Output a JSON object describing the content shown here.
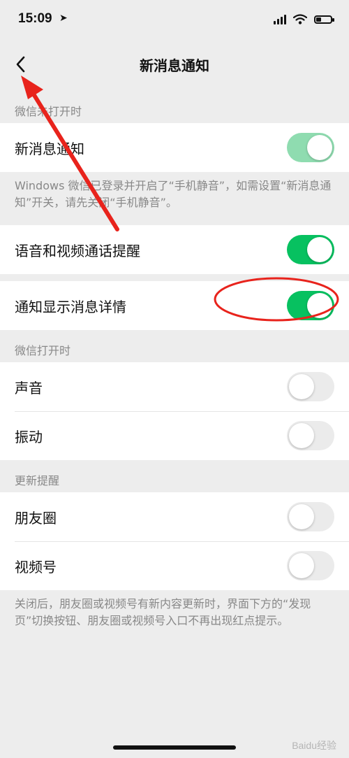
{
  "status_bar": {
    "time": "15:09",
    "location_icon": "location-arrow-icon",
    "battery_level": 0.35
  },
  "nav": {
    "title": "新消息通知",
    "back_icon": "chevron-left-icon"
  },
  "sections": {
    "pc_open": {
      "label": "微信未打开时",
      "items": [
        {
          "label": "新消息通知",
          "enabled": true
        }
      ],
      "note": "Windows 微信已登录并开启了“手机静音”，如需设置“新消息通知”开关，请先关闭“手机静音”。"
    },
    "call_reminder": {
      "label": "语音和视频通话提醒",
      "enabled": true
    },
    "show_details": {
      "label": "通知显示消息详情",
      "enabled": true
    },
    "wechat_open": {
      "label": "微信打开时",
      "items": [
        {
          "label": "声音",
          "enabled": false
        },
        {
          "label": "振动",
          "enabled": false
        }
      ]
    },
    "updates": {
      "label": "更新提醒",
      "items": [
        {
          "label": "朋友圈",
          "enabled": false
        },
        {
          "label": "视频号",
          "enabled": false
        }
      ],
      "note": "关闭后，朋友圈或视频号有新内容更新时，界面下方的“发现页”切换按钮、朋友圈或视频号入口不再出现红点提示。"
    }
  },
  "watermark": "Baidu经验",
  "colors": {
    "switch_on": "#07c160",
    "switch_off": "#ebebeb",
    "annotation_red": "#e8231c",
    "background": "#ededed"
  }
}
